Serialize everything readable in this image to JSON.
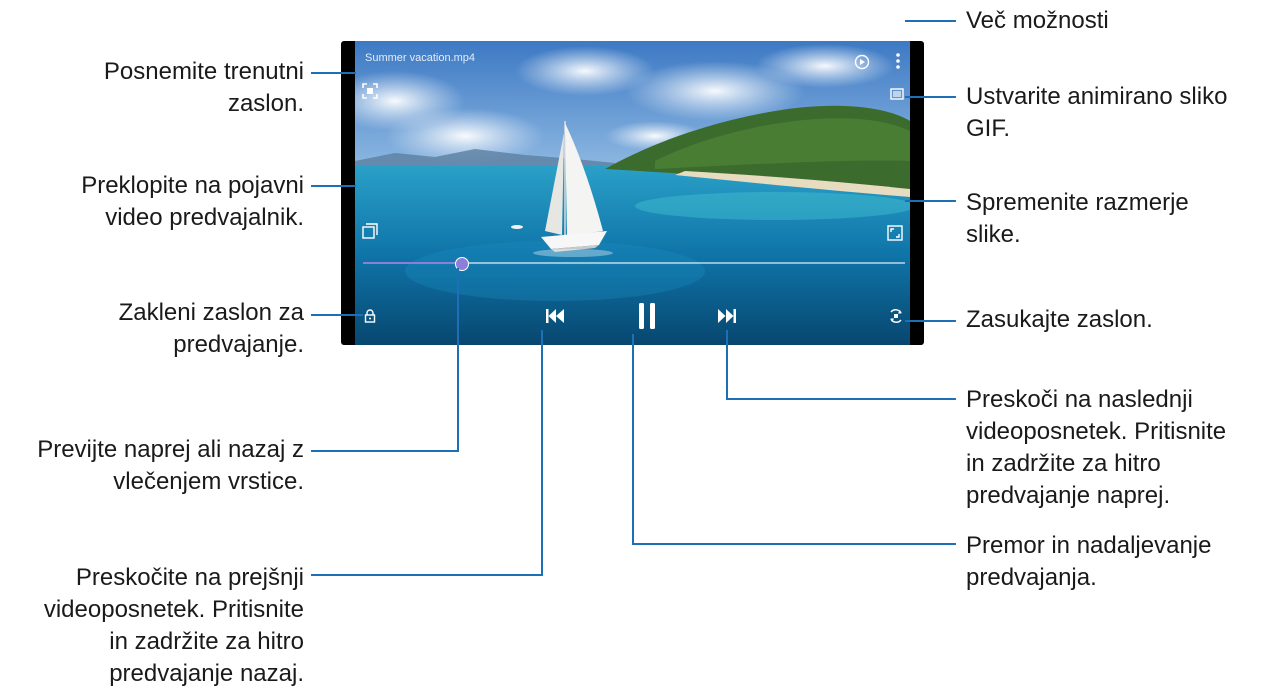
{
  "video_title": "Summer vacation.mp4",
  "progress": 0.18,
  "annotations": {
    "capture": "Posnemite trenutni\nzaslon.",
    "popup": "Preklopite na pojavni\nvideo predvajalnik.",
    "lock": "Zakleni zaslon za\npredvajanje.",
    "seek": "Previjte naprej ali nazaj z\nvlečenjem vrstice.",
    "prev": "Preskočite na prejšnji\nvideoposnetek. Pritisnite\nin zadržite za hitro\npredvajanje nazaj.",
    "more": "Več možnosti",
    "gif": "Ustvarite animirano sliko\nGIF.",
    "ratio": "Spremenite razmerje\nslike.",
    "rotate": "Zasukajte zaslon.",
    "next": "Preskoči na naslednji\nvideoposnetek. Pritisnite\nin zadržite za hitro\npredvajanje naprej.",
    "pause": "Premor in nadaljevanje\npredvajanja."
  },
  "colors": {
    "callout_line": "#1d70b7",
    "seek_thumb": "#8b7fd9"
  },
  "icons": [
    "capture-icon",
    "popup-icon",
    "lock-icon",
    "previous-icon",
    "pause-icon",
    "next-icon",
    "rotate-icon",
    "aspect-ratio-icon",
    "gif-icon",
    "more-options-icon",
    "video-editor-icon"
  ]
}
